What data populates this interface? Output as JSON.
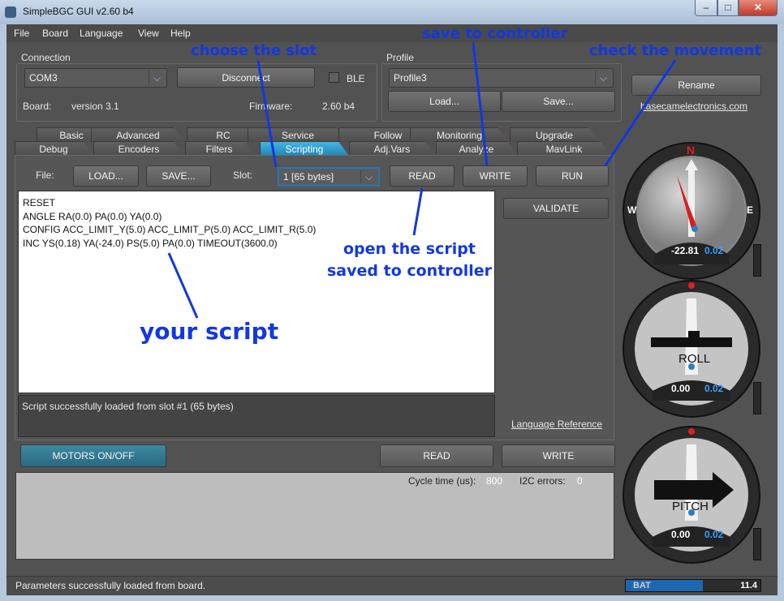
{
  "window": {
    "title": "SimpleBGC GUI v2.60 b4",
    "min": "–",
    "max": "□",
    "close": "✕"
  },
  "menu": [
    "File",
    "Board",
    "Language",
    "View",
    "Help"
  ],
  "connection": {
    "label": "Connection",
    "port": "COM3",
    "disconnect": "Disconnect",
    "ble": "BLE",
    "board_label": "Board:",
    "board_value": "version 3.1",
    "firmware_label": "Firmware:",
    "firmware_value": "2.60 b4"
  },
  "profile": {
    "label": "Profile",
    "selected": "Profile3",
    "load": "Load...",
    "save": "Save...",
    "rename": "Rename",
    "link": "basecamelectronics.com"
  },
  "tabs_top": [
    "Basic",
    "Advanced",
    "RC",
    "Service",
    "Follow",
    "Monitoring",
    "Upgrade"
  ],
  "tabs_bottom": [
    "Debug",
    "Encoders",
    "Filters",
    "Scripting",
    "Adj.Vars",
    "Analyze",
    "MavLink"
  ],
  "script_toolbar": {
    "file_label": "File:",
    "load": "LOAD...",
    "save": "SAVE...",
    "slot_label": "Slot:",
    "slot_value": "1 [65 bytes]",
    "read": "READ",
    "write": "WRITE",
    "run": "RUN",
    "validate": "VALIDATE"
  },
  "script_lines": [
    "RESET",
    "ANGLE RA(0.0) PA(0.0) YA(0.0)",
    "CONFIG ACC_LIMIT_Y(5.0) ACC_LIMIT_P(5.0) ACC_LIMIT_R(5.0)",
    "INC YS(0.18) YA(-24.0) PS(5.0) PA(0.0) TIMEOUT(3600.0)"
  ],
  "script_status": "Script successfully loaded from slot #1 (65 bytes)",
  "language_reference": "Language Reference",
  "bottom": {
    "motors": "MOTORS ON/OFF",
    "read": "READ",
    "write": "WRITE",
    "cycle_label": "Cycle time (us):",
    "cycle_value": "800",
    "i2c_label": "I2C errors:",
    "i2c_value": "0"
  },
  "statusbar": {
    "text": "Parameters successfully loaded from board.",
    "bat_label": "BAT",
    "bat_value": "11.4",
    "bat_level": 0.57
  },
  "gauges": {
    "yaw": {
      "n": "N",
      "w": "W",
      "e": "E",
      "value": "-22.81",
      "speed": "0.02"
    },
    "roll": {
      "label": "ROLL",
      "value": "0.00",
      "speed": "0.02"
    },
    "pitch": {
      "label": "PITCH",
      "value": "0.00",
      "speed": "0.02"
    }
  },
  "annotations": {
    "slot": "choose the slot",
    "save": "save to controller",
    "movement": "check the movement",
    "open1": "open the script",
    "open2": "saved to controller",
    "script": "your script"
  },
  "colors": {
    "accent": "#1f86b8",
    "annotation": "#1238e0",
    "battery": "#1e67b0",
    "marker": "#e02020"
  }
}
